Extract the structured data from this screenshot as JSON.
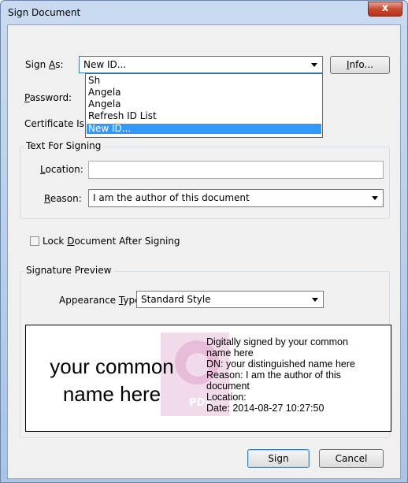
{
  "window": {
    "title": "Sign Document",
    "close_label": "x"
  },
  "sign_as": {
    "label_pre": "Sign ",
    "label_accel": "A",
    "label_post": "s:",
    "value": "New ID...",
    "options": [
      "Sh",
      "Angela",
      "Angela",
      "Refresh ID List",
      "New ID..."
    ],
    "selected_index": 4
  },
  "info_button": {
    "accel": "I",
    "rest": "nfo..."
  },
  "password": {
    "accel": "P",
    "rest": "assword:"
  },
  "certificate_issuer": {
    "label": "Certificate Is"
  },
  "text_for_signing": {
    "title": "Text For Signing",
    "location_label_pre": "",
    "location_accel": "L",
    "location_rest": "ocation:",
    "location_value": "",
    "reason_accel": "R",
    "reason_rest": "eason:",
    "reason_value": "I am the author of this document"
  },
  "lock_document": {
    "pre": "Lock ",
    "accel": "D",
    "rest": "ocument After Signing",
    "checked": false
  },
  "signature_preview": {
    "title": "Signature Preview",
    "appearance_pre": "Appearance ",
    "appearance_accel": "T",
    "appearance_rest": "ype:",
    "appearance_value": "Standard Style",
    "name_line1": "your common",
    "name_line2": "name here",
    "logo_text": "PDF",
    "details": [
      "Digitally signed by your common",
      "name here",
      "DN: your distinguished name here",
      "Reason: I am the author of this",
      "document",
      "Location:",
      "Date: 2014-08-27 10:27:50"
    ]
  },
  "buttons": {
    "sign": "Sign",
    "cancel": "Cancel"
  }
}
